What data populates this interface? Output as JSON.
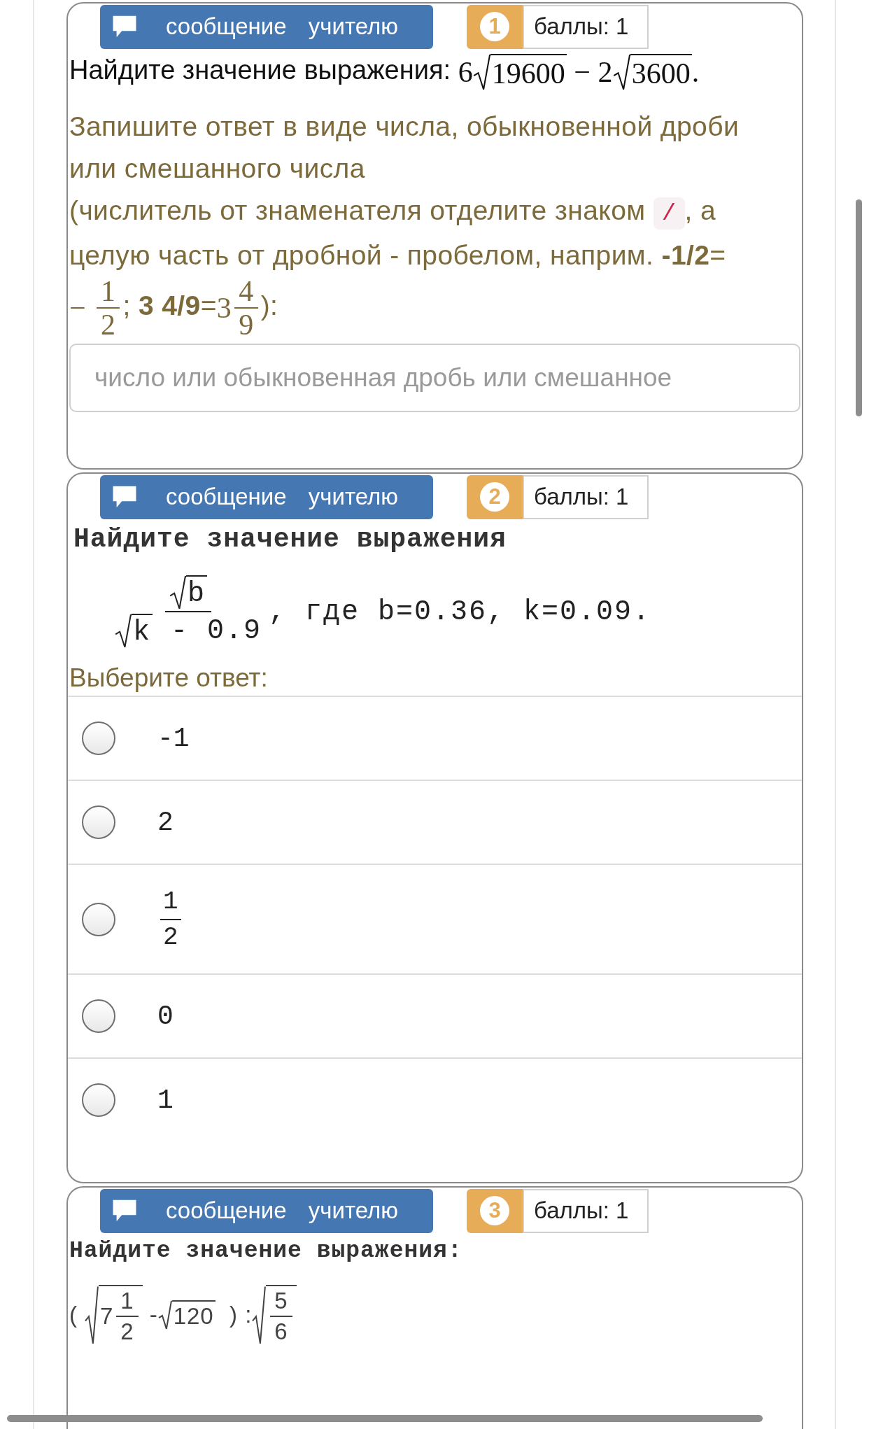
{
  "questions": [
    {
      "kind": "input",
      "number": "1",
      "message_button": "сообщение учителю",
      "score": "баллы: 1",
      "prompt": "Найдите значение выражения:",
      "math": [
        {
          "kind": "text",
          "t": "6"
        },
        {
          "kind": "sqrt",
          "body": [
            {
              "kind": "text",
              "t": "19600"
            }
          ]
        },
        {
          "kind": "text",
          "t": " − 2"
        },
        {
          "kind": "sqrt",
          "body": [
            {
              "kind": "text",
              "t": "3600"
            }
          ]
        },
        {
          "kind": "text",
          "t": "."
        }
      ],
      "hint": [
        [
          {
            "kind": "text",
            "t": "Запишите ответ в виде числа, обыкновенной дроби или смешанного числа"
          }
        ],
        [
          {
            "kind": "text",
            "t": "(числитель от знаменателя отделите знаком "
          },
          {
            "kind": "code",
            "t": "/"
          },
          {
            "kind": "text",
            "t": ", а целую часть от дробной - пробелом, наприм. **-1/2**="
          },
          {
            "kind": "math",
            "nodes": [
              {
                "kind": "text",
                "t": "− "
              },
              {
                "kind": "frac",
                "num": [
                  {
                    "kind": "text",
                    "t": "1"
                  }
                ],
                "den": [
                  {
                    "kind": "text",
                    "t": "2"
                  }
                ]
              }
            ]
          },
          {
            "kind": "text",
            "t": "; **3 4/9**="
          },
          {
            "kind": "math",
            "nodes": [
              {
                "kind": "text",
                "t": "3"
              },
              {
                "kind": "frac",
                "num": [
                  {
                    "kind": "text",
                    "t": "4"
                  }
                ],
                "den": [
                  {
                    "kind": "text",
                    "t": "9"
                  }
                ]
              }
            ]
          },
          {
            "kind": "text",
            "t": "):"
          }
        ]
      ],
      "answer": {
        "placeholder": "число или обыкновенная дробь или смешанное"
      }
    },
    {
      "kind": "choice",
      "number": "2",
      "message_button": "сообщение учителю",
      "score": "баллы: 1",
      "prompt": "Найдите значение выражения",
      "formula": [
        {
          "kind": "frac",
          "num": [
            {
              "kind": "sqrt",
              "body": [
                {
                  "kind": "text",
                  "t": "b"
                }
              ]
            }
          ],
          "den": [
            {
              "kind": "sqrt",
              "body": [
                {
                  "kind": "text",
                  "t": "k"
                }
              ]
            },
            {
              "kind": "text",
              "t": " - 0.9"
            }
          ]
        },
        {
          "kind": "text",
          "t": ", где b=0.36, k=0.09."
        }
      ],
      "choose_label": "Выберите ответ:",
      "options": [
        {
          "kind": "text",
          "label": "-1",
          "selected": false
        },
        {
          "kind": "text",
          "label": "2",
          "selected": false
        },
        {
          "kind": "fraction",
          "num": "1",
          "den": "2",
          "selected": false
        },
        {
          "kind": "text",
          "label": "0",
          "selected": false
        },
        {
          "kind": "text",
          "label": "1",
          "selected": false
        }
      ]
    },
    {
      "kind": "partial",
      "number": "3",
      "message_button": "сообщение учителю",
      "score": "баллы: 1",
      "prompt": "Найдите значение выражения:",
      "formula": [
        {
          "kind": "text",
          "t": "( "
        },
        {
          "kind": "sqrt",
          "body": [
            {
              "kind": "text",
              "t": "7"
            },
            {
              "kind": "frac",
              "num": [
                {
                  "kind": "text",
                  "t": "1"
                }
              ],
              "den": [
                {
                  "kind": "text",
                  "t": "2"
                }
              ]
            }
          ]
        },
        {
          "kind": "text",
          "t": " -"
        },
        {
          "kind": "sqrt",
          "body": [
            {
              "kind": "text",
              "t": "120"
            }
          ]
        },
        {
          "kind": "text",
          "t": "  ) :"
        },
        {
          "kind": "sqrt",
          "body": [
            {
              "kind": "frac",
              "num": [
                {
                  "kind": "text",
                  "t": "5"
                }
              ],
              "den": [
                {
                  "kind": "text",
                  "t": "6"
                }
              ]
            }
          ]
        }
      ]
    }
  ]
}
